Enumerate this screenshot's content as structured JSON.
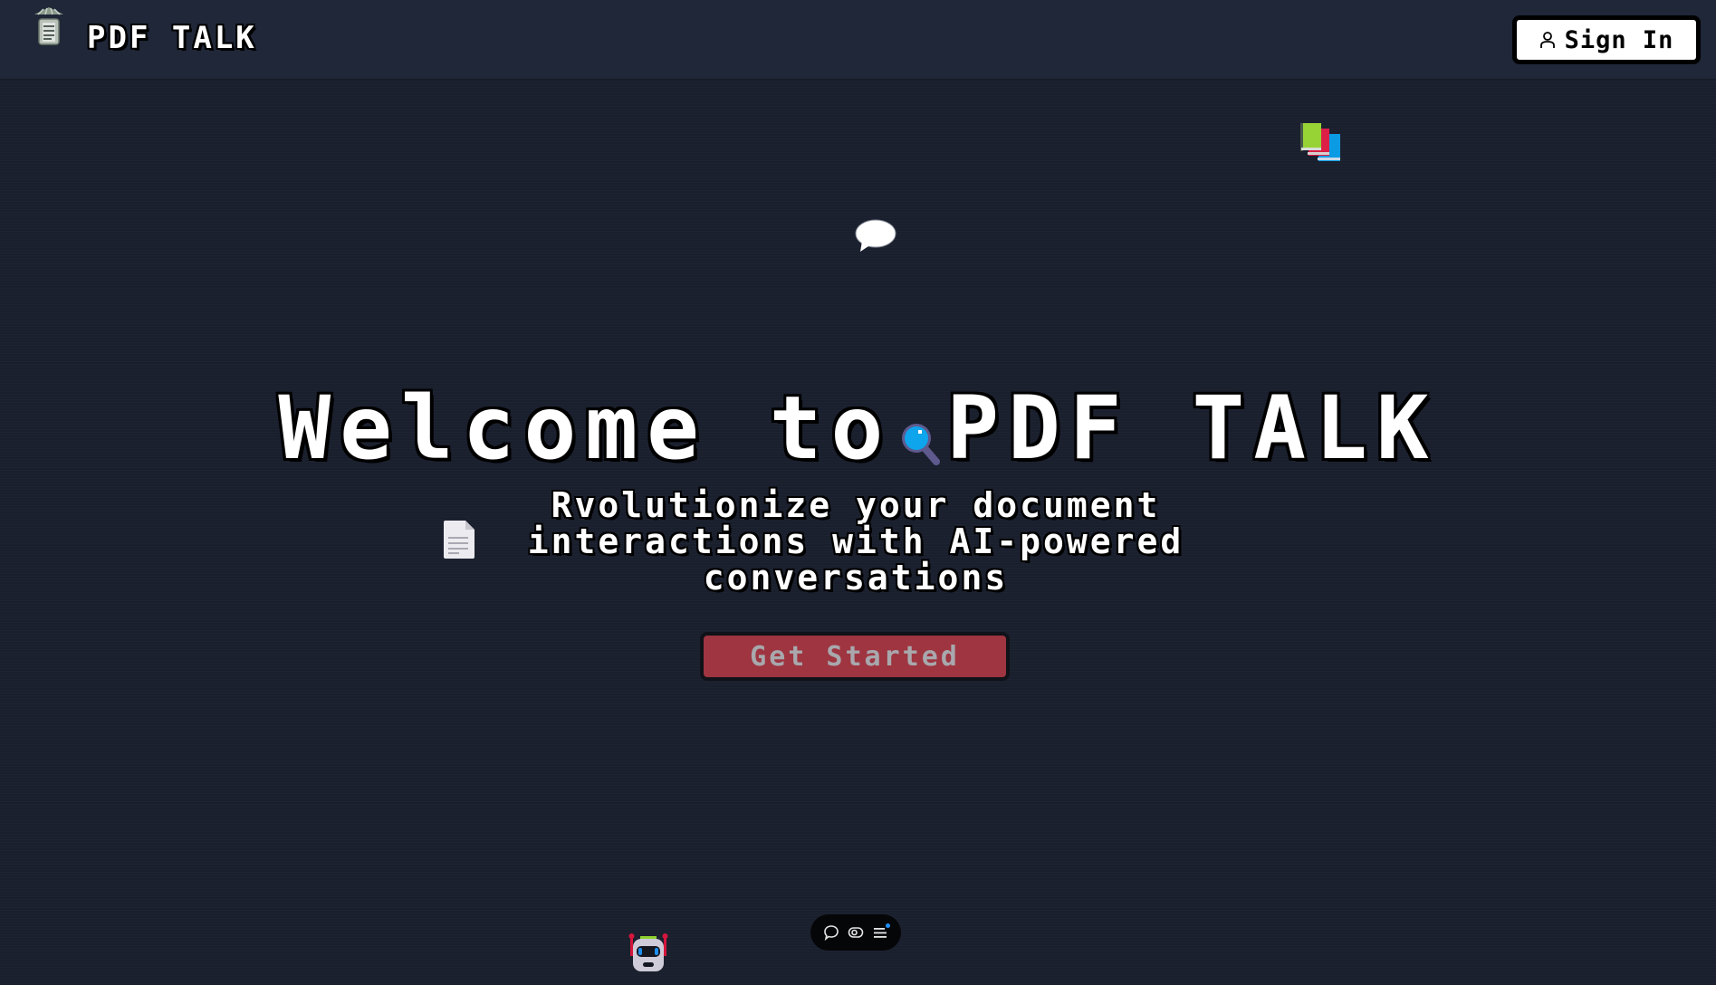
{
  "header": {
    "brand": "PDF TALK",
    "logo_icon": "document-stack-icon",
    "sign_in_label": "Sign In",
    "sign_in_icon": "user-icon"
  },
  "hero": {
    "title_part1": "Welcome to",
    "title_part2": "PDF TALK",
    "subtitle_lines": [
      "Rvolutionize your document",
      "interactions with AI-powered",
      "conversations"
    ],
    "cta_label": "Get Started"
  },
  "decorations": [
    "books-icon",
    "speech-bubble-icon",
    "magnifier-icon",
    "document-icon",
    "robot-icon"
  ],
  "dock": {
    "items": [
      "chat-icon",
      "eye-icon",
      "menu-icon"
    ]
  },
  "colors": {
    "background": "#1a1f2d",
    "header": "#1f2738",
    "cta": "#9e3540",
    "cta_text": "#a8a8ad"
  }
}
